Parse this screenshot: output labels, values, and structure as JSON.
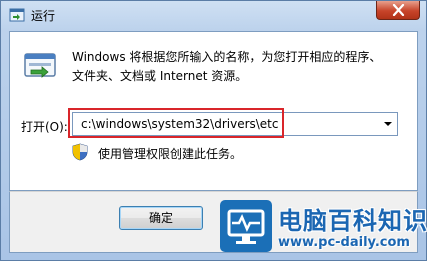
{
  "window": {
    "title": "运行"
  },
  "description": {
    "line1": "Windows 将根据您所输入的名称，为您打开相应的程序、",
    "line2": "文件夹、文档或 Internet 资源。"
  },
  "open_field": {
    "label": "打开(O):",
    "value": "c:\\windows\\system32\\drivers\\etc"
  },
  "admin_note": "使用管理权限创建此任务。",
  "buttons": {
    "ok": "确定"
  },
  "watermark": {
    "title": "电脑百科知识",
    "url": "www.pc-daily.com"
  },
  "icons": {
    "app": "run-icon",
    "close": "close-icon",
    "dropdown": "chevron-down-icon",
    "shield": "uac-shield-icon"
  },
  "colors": {
    "highlight": "#d9252a",
    "brand": "#1b66b2"
  }
}
